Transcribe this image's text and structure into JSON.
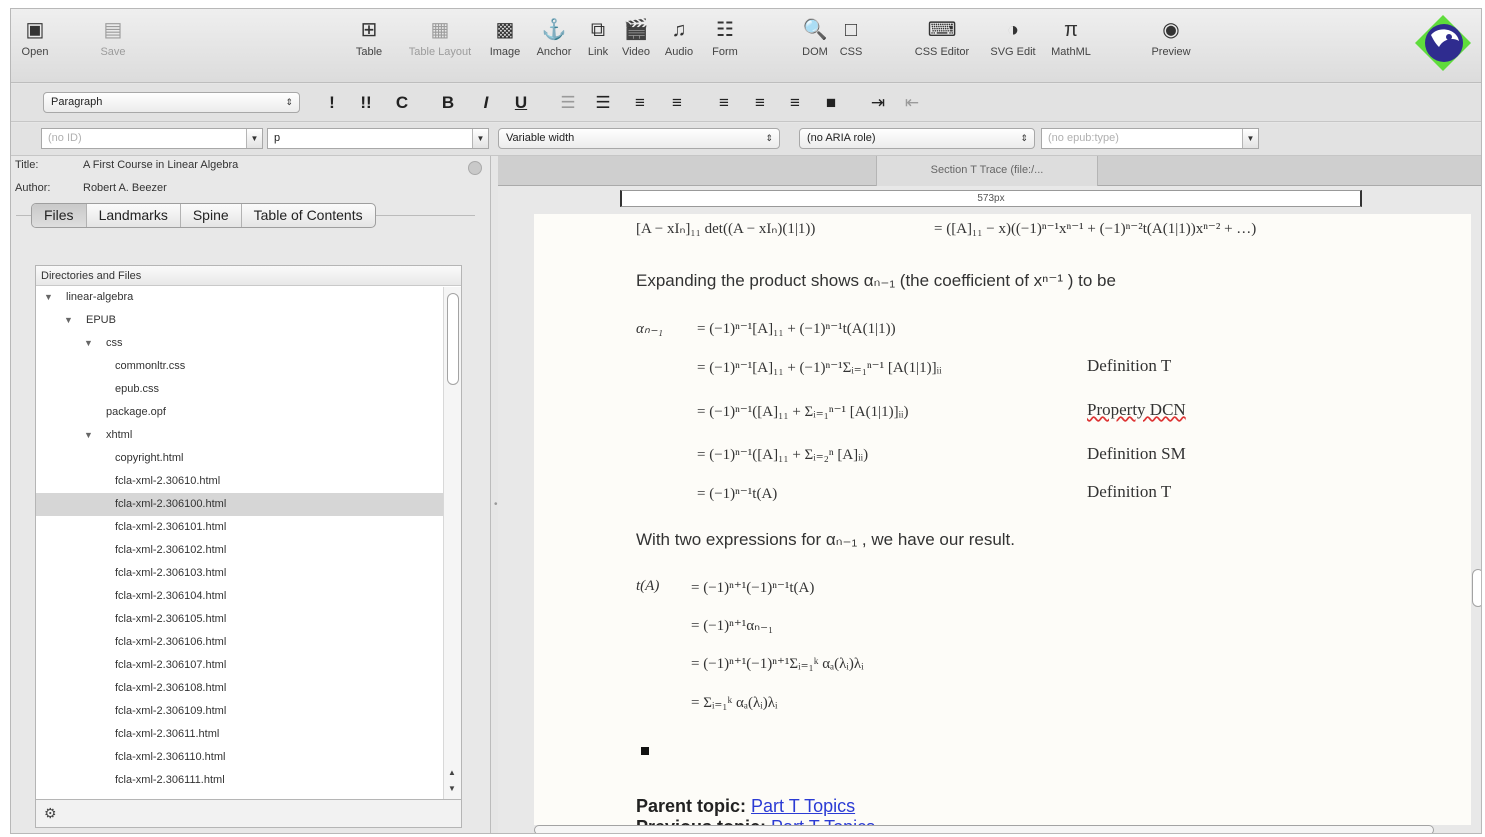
{
  "toolbar": {
    "open": "Open",
    "save": "Save",
    "table": "Table",
    "table_layout": "Table Layout",
    "image": "Image",
    "anchor": "Anchor",
    "link": "Link",
    "video": "Video",
    "audio": "Audio",
    "form": "Form",
    "dom": "DOM",
    "css": "CSS",
    "css_editor": "CSS Editor",
    "svg_edit": "SVG Edit",
    "mathml": "MathML",
    "preview": "Preview"
  },
  "formatbar": {
    "paragraph_select": "Paragraph",
    "buttons": {
      "b1": "!",
      "b2": "!!",
      "c": "C",
      "bold": "B",
      "italic": "I",
      "underline": "U"
    }
  },
  "attrbar": {
    "id_placeholder": "(no ID)",
    "element": "p",
    "width": "Variable width",
    "aria": "(no ARIA role)",
    "epub_type": "(no epub:type)"
  },
  "meta": {
    "title_label": "Title:",
    "title_value": "A First Course in Linear Algebra",
    "author_label": "Author:",
    "author_value": "Robert A. Beezer"
  },
  "tabs": [
    "Files",
    "Landmarks",
    "Spine",
    "Table of Contents"
  ],
  "tree": {
    "header": "Directories and Files",
    "rows": [
      {
        "name": "linear-algebra",
        "indent": 0,
        "expanded": true
      },
      {
        "name": "EPUB",
        "indent": 1,
        "expanded": true
      },
      {
        "name": "css",
        "indent": 2,
        "expanded": true
      },
      {
        "name": "commonltr.css",
        "indent": 3
      },
      {
        "name": "epub.css",
        "indent": 3
      },
      {
        "name": "package.opf",
        "indent": 2
      },
      {
        "name": "xhtml",
        "indent": 2,
        "expanded": true
      },
      {
        "name": "copyright.html",
        "indent": 3
      },
      {
        "name": "fcla-xml-2.30610.html",
        "indent": 3
      },
      {
        "name": "fcla-xml-2.306100.html",
        "indent": 3,
        "selected": true
      },
      {
        "name": "fcla-xml-2.306101.html",
        "indent": 3
      },
      {
        "name": "fcla-xml-2.306102.html",
        "indent": 3
      },
      {
        "name": "fcla-xml-2.306103.html",
        "indent": 3
      },
      {
        "name": "fcla-xml-2.306104.html",
        "indent": 3
      },
      {
        "name": "fcla-xml-2.306105.html",
        "indent": 3
      },
      {
        "name": "fcla-xml-2.306106.html",
        "indent": 3
      },
      {
        "name": "fcla-xml-2.306107.html",
        "indent": 3
      },
      {
        "name": "fcla-xml-2.306108.html",
        "indent": 3
      },
      {
        "name": "fcla-xml-2.306109.html",
        "indent": 3
      },
      {
        "name": "fcla-xml-2.30611.html",
        "indent": 3
      },
      {
        "name": "fcla-xml-2.306110.html",
        "indent": 3
      },
      {
        "name": "fcla-xml-2.306111.html",
        "indent": 3
      }
    ]
  },
  "editor": {
    "doc_tab": "Section T  Trace (file:/...",
    "ruler": "573px",
    "line0_left": "[A − xIₙ]₁₁  det((A − xIₙ)(1|1))",
    "line0_right": "= ([A]₁₁ − x)((−1)ⁿ⁻¹xⁿ⁻¹ + (−1)ⁿ⁻²t(A(1|1))xⁿ⁻² + …)",
    "para1": "Expanding the product shows αₙ₋₁ (the coefficient of xⁿ⁻¹ ) to be",
    "eq1_lhs": "αₙ₋₁",
    "eq1": [
      "= (−1)ⁿ⁻¹[A]₁₁ + (−1)ⁿ⁻¹t(A(1|1))",
      "= (−1)ⁿ⁻¹[A]₁₁ + (−1)ⁿ⁻¹Σᵢ₌₁ⁿ⁻¹ [A(1|1)]ᵢᵢ",
      "= (−1)ⁿ⁻¹([A]₁₁ + Σᵢ₌₁ⁿ⁻¹ [A(1|1)]ᵢᵢ)",
      "= (−1)ⁿ⁻¹([A]₁₁ + Σᵢ₌₂ⁿ [A]ᵢᵢ)",
      "= (−1)ⁿ⁻¹t(A)"
    ],
    "refs": [
      "Definition T",
      "Property DCN",
      "Definition SM",
      "Definition T"
    ],
    "para2": "With two expressions for αₙ₋₁ , we have our result.",
    "eq2_lhs": "t(A)",
    "eq2": [
      "= (−1)ⁿ⁺¹(−1)ⁿ⁻¹t(A)",
      "= (−1)ⁿ⁺¹αₙ₋₁",
      "= (−1)ⁿ⁺¹(−1)ⁿ⁺¹Σᵢ₌₁ᵏ αₐ(λᵢ)λᵢ",
      "= Σᵢ₌₁ᵏ αₐ(λᵢ)λᵢ"
    ],
    "parent_label": "Parent topic:",
    "parent_link": "Part T  Topics",
    "prev_label": "Previous topic:",
    "prev_link": "Part T  Topics"
  }
}
